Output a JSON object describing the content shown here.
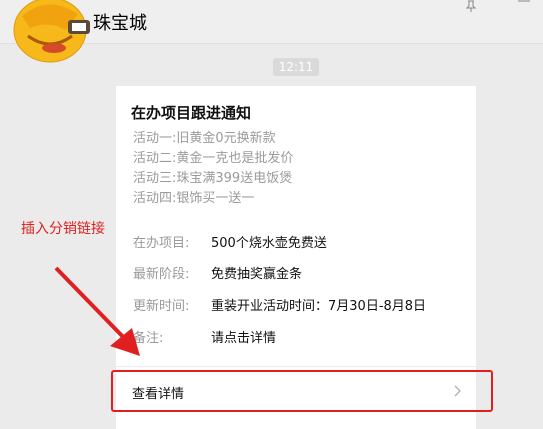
{
  "header": {
    "title": "珠宝城",
    "avatar_icon": "facepalm-emoji-avatar",
    "pin_icon": "pin-icon",
    "more_icon": "more-icon"
  },
  "timestamp": "12:11",
  "card": {
    "title": "在办项目跟进通知",
    "activities": [
      "活动一:旧黄金0元换新款",
      "活动二:黄金一克也是批发价",
      "活动三:珠宝满399送电饭煲",
      "活动四:银饰买一送一"
    ],
    "fields": [
      {
        "label": "在办项目:",
        "value": "500个烧水壶免费送"
      },
      {
        "label": "最新阶段:",
        "value": "免费抽奖赢金条"
      },
      {
        "label": "更新时间:",
        "value": "重装开业活动时间：7月30日-8月8日"
      },
      {
        "label": "备注:",
        "value": "请点击详情"
      }
    ],
    "details_label": "查看详情",
    "chevron_icon": "chevron-right-icon"
  },
  "annotation": {
    "text": "插入分销链接",
    "color": "#e02020"
  }
}
